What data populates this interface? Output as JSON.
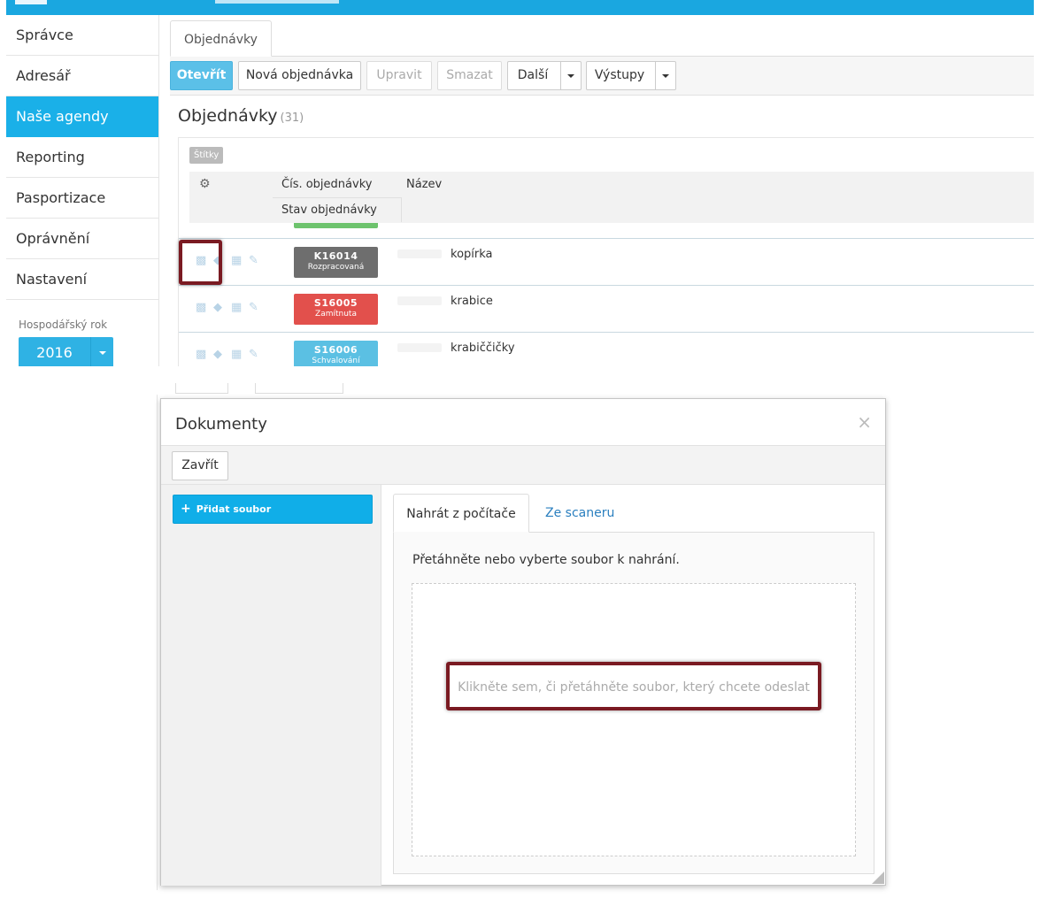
{
  "sidebar": {
    "items": [
      {
        "label": "Správce",
        "active": false
      },
      {
        "label": "Adresář",
        "active": false
      },
      {
        "label": "Naše agendy",
        "active": true
      },
      {
        "label": "Reporting",
        "active": false
      },
      {
        "label": "Pasportizace",
        "active": false
      },
      {
        "label": "Oprávnění",
        "active": false
      },
      {
        "label": "Nastavení",
        "active": false
      }
    ],
    "fiscal_year_label": "Hospodářský rok",
    "fiscal_year_value": "2016"
  },
  "tab": {
    "label": "Objednávky"
  },
  "toolbar": {
    "open": "Otevřít",
    "new_order": "Nová objednávka",
    "edit": "Upravit",
    "delete": "Smazat",
    "more": "Další",
    "outputs": "Výstupy"
  },
  "list": {
    "title": "Objednávky",
    "count": "(31)",
    "tags_label": "Štítky",
    "columns": {
      "number": "Čís. objednávky",
      "name": "Název",
      "state": "Stav objednávky"
    },
    "rows": [
      {
        "number": "K16014",
        "state": "Rozpracovaná",
        "name": "kopírka",
        "color": "#6e6e6e"
      },
      {
        "number": "S16005",
        "state": "Zamítnuta",
        "name": "krabice",
        "color": "#e2504c"
      },
      {
        "number": "S16006",
        "state": "Schvalování",
        "name": "krabiččičky",
        "color": "#5bc0e3"
      }
    ]
  },
  "colors": {
    "accent": "#1ab0e8",
    "highlight": "#7a1a22"
  },
  "modal": {
    "title": "Dokumenty",
    "close_label": "Zavřít",
    "add_file_label": "Přidat soubor",
    "tabs": {
      "local": "Nahrát z počítače",
      "scanner": "Ze scaneru"
    },
    "instructions": "Přetáhněte nebo vyberte soubor k nahrání.",
    "dropzone_text": "Klikněte sem, či přetáhněte soubor, který chcete odeslat"
  }
}
